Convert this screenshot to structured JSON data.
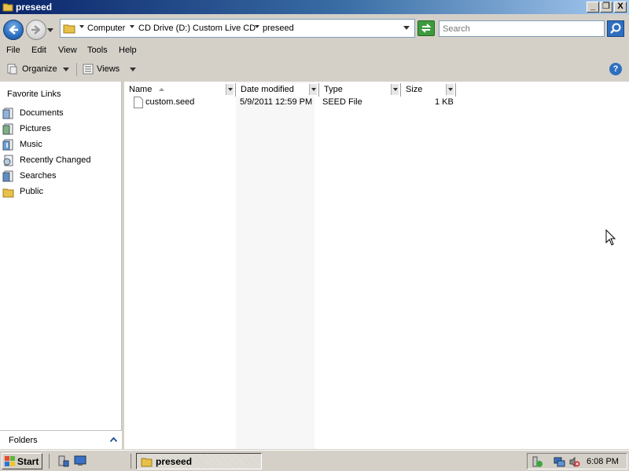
{
  "window": {
    "title": "preseed",
    "controls": {
      "minimize": "_",
      "restore": "❐",
      "close": "X"
    }
  },
  "address": {
    "breadcrumbs": [
      "Computer",
      "CD Drive (D:) Custom Live CD",
      "preseed"
    ],
    "search_placeholder": "Search"
  },
  "menu": [
    "File",
    "Edit",
    "View",
    "Tools",
    "Help"
  ],
  "toolbar": {
    "organize": "Organize",
    "views": "Views",
    "help": "?"
  },
  "nav": {
    "header": "Favorite Links",
    "links": [
      "Documents",
      "Pictures",
      "Music",
      "Recently Changed",
      "Searches",
      "Public"
    ],
    "folders_label": "Folders"
  },
  "columns": [
    "Name",
    "Date modified",
    "Type",
    "Size"
  ],
  "files": [
    {
      "name": "custom.seed",
      "date_modified": "5/9/2011 12:59 PM",
      "type": "SEED File",
      "size": "1 KB"
    }
  ],
  "taskbar": {
    "start_label": "Start",
    "task_label": "preseed",
    "clock": "6:08 PM"
  },
  "colors": {
    "title_gradient_start": "#0a246a",
    "title_gradient_end": "#a6caf0",
    "chrome": "#d4d0c8"
  }
}
